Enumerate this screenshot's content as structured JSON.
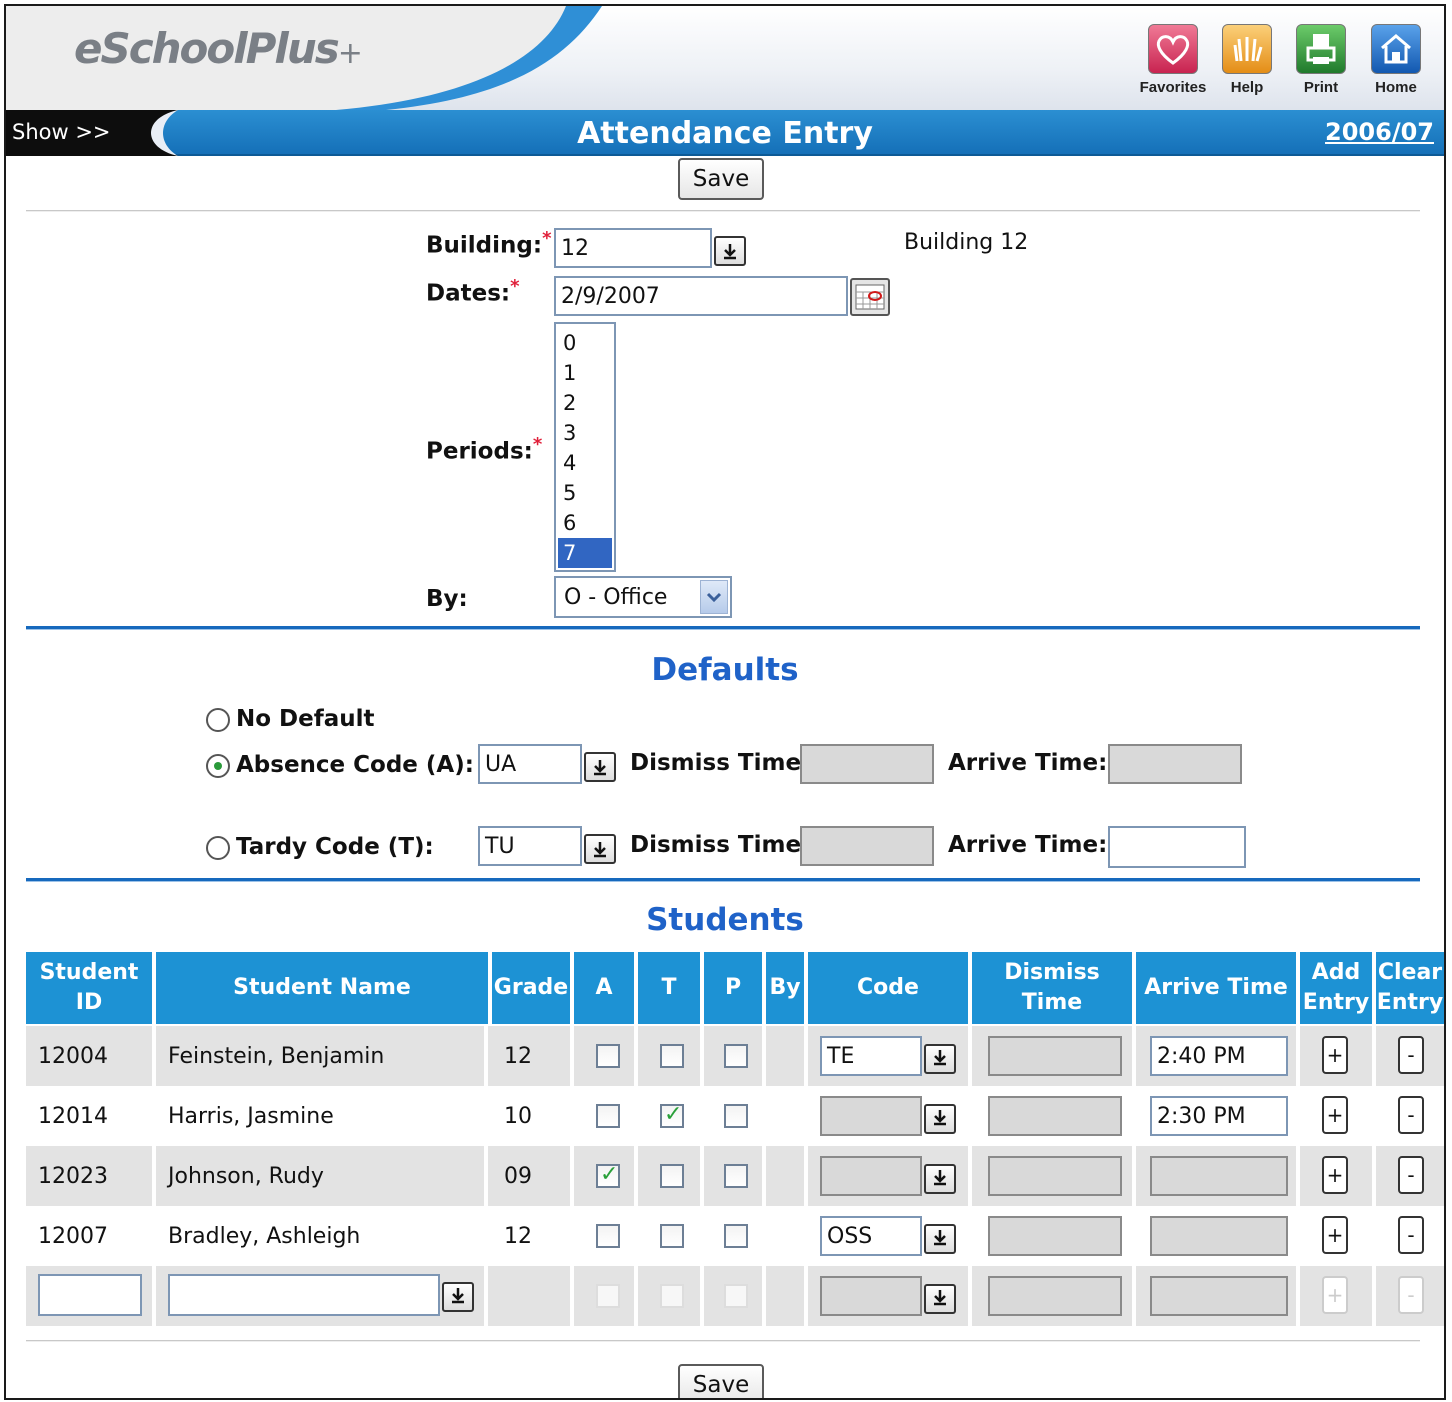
{
  "app": {
    "logo": "eSchoolPlus",
    "logo_plus": "+"
  },
  "toolbar": [
    {
      "label": "Favorites",
      "icon": "heart-icon",
      "color": "#d8385a"
    },
    {
      "label": "Help",
      "icon": "hand-icon",
      "color": "#f2a42a"
    },
    {
      "label": "Print",
      "icon": "printer-icon",
      "color": "#2e9a3c"
    },
    {
      "label": "Home",
      "icon": "home-icon",
      "color": "#1c6cc6"
    }
  ],
  "titlebar": {
    "show": "Show >>",
    "title": "Attendance Entry",
    "year": "2006/07"
  },
  "save_label": "Save",
  "form": {
    "building_label": "Building:",
    "building_value": "12",
    "building_name": "Building 12",
    "dates_label": "Dates:",
    "dates_value": "2/9/2007",
    "periods_label": "Periods:",
    "periods": [
      "0",
      "1",
      "2",
      "3",
      "4",
      "5",
      "6",
      "7"
    ],
    "periods_selected": "7",
    "by_label": "By:",
    "by_value": "O - Office",
    "required_mark": "*"
  },
  "defaults": {
    "heading": "Defaults",
    "no_default": "No Default",
    "absence_label": "Absence Code (A):",
    "absence_value": "UA",
    "tardy_label": "Tardy Code (T):",
    "tardy_value": "TU",
    "dismiss_label": "Dismiss Time:",
    "arrive_label": "Arrive Time:",
    "selected": "absence"
  },
  "students": {
    "heading": "Students",
    "columns": {
      "id": "Student ID",
      "name": "Student Name",
      "grade": "Grade",
      "a": "A",
      "t": "T",
      "p": "P",
      "by": "By",
      "code": "Code",
      "dismiss": "Dismiss Time",
      "arrive": "Arrive Time",
      "add": "Add Entry",
      "clear": "Clear Entry"
    },
    "rows": [
      {
        "id": "12004",
        "name": "Feinstein, Benjamin",
        "grade": "12",
        "a": false,
        "t": false,
        "p": false,
        "code": "TE",
        "arrive": "2:40 PM"
      },
      {
        "id": "12014",
        "name": "Harris, Jasmine",
        "grade": "10",
        "a": false,
        "t": true,
        "p": false,
        "code": "",
        "arrive": "2:30 PM"
      },
      {
        "id": "12023",
        "name": "Johnson, Rudy",
        "grade": "09",
        "a": true,
        "t": false,
        "p": false,
        "code": "",
        "arrive": ""
      },
      {
        "id": "12007",
        "name": "Bradley, Ashleigh",
        "grade": "12",
        "a": false,
        "t": false,
        "p": false,
        "code": "OSS",
        "arrive": ""
      }
    ],
    "plus": "+",
    "minus": "-"
  }
}
